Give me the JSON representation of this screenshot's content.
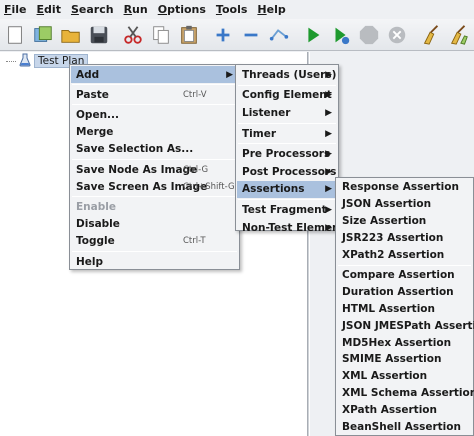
{
  "menubar": [
    {
      "label": "File",
      "mnemonic": "F",
      "rest": "ile"
    },
    {
      "label": "Edit",
      "mnemonic": "E",
      "rest": "dit"
    },
    {
      "label": "Search",
      "mnemonic": "S",
      "rest": "earch"
    },
    {
      "label": "Run",
      "mnemonic": "R",
      "rest": "un"
    },
    {
      "label": "Options",
      "mnemonic": "O",
      "rest": "ptions"
    },
    {
      "label": "Tools",
      "mnemonic": "T",
      "rest": "ools"
    },
    {
      "label": "Help",
      "mnemonic": "H",
      "rest": "elp"
    }
  ],
  "toolbar": [
    {
      "icon": "new-file-icon"
    },
    {
      "icon": "templates-icon"
    },
    {
      "icon": "open-folder-icon"
    },
    {
      "icon": "save-icon"
    },
    {
      "sep": true
    },
    {
      "icon": "cut-icon"
    },
    {
      "icon": "copy-icon"
    },
    {
      "icon": "paste-icon"
    },
    {
      "sep": true
    },
    {
      "icon": "expand-plus-icon"
    },
    {
      "icon": "collapse-minus-icon"
    },
    {
      "icon": "toggle-icon"
    },
    {
      "sep": true
    },
    {
      "icon": "start-icon"
    },
    {
      "icon": "start-no-pauses-icon"
    },
    {
      "icon": "stop-icon"
    },
    {
      "icon": "shutdown-icon"
    },
    {
      "sep": true
    },
    {
      "icon": "clear-icon"
    },
    {
      "icon": "clear-all-icon"
    }
  ],
  "tree": {
    "root_label": "Test Plan"
  },
  "context_menu": [
    {
      "label": "Add",
      "submenu": true,
      "highlight": true
    },
    {
      "sep": true
    },
    {
      "label": "Paste",
      "accel": "Ctrl-V"
    },
    {
      "sep": true
    },
    {
      "label": "Open..."
    },
    {
      "label": "Merge"
    },
    {
      "label": "Save Selection As..."
    },
    {
      "sep": true
    },
    {
      "label": "Save Node As Image",
      "accel": "Ctrl-G"
    },
    {
      "label": "Save Screen As Image",
      "accel": "Ctrl+Shift-G"
    },
    {
      "sep": true
    },
    {
      "label": "Enable",
      "disabled": true
    },
    {
      "label": "Disable"
    },
    {
      "label": "Toggle",
      "accel": "Ctrl-T"
    },
    {
      "sep": true
    },
    {
      "label": "Help"
    }
  ],
  "add_menu": [
    {
      "label": "Threads (Users)",
      "submenu": true
    },
    {
      "sep": true
    },
    {
      "label": "Config Element",
      "submenu": true
    },
    {
      "label": "Listener",
      "submenu": true
    },
    {
      "sep": true
    },
    {
      "label": "Timer",
      "submenu": true
    },
    {
      "sep": true
    },
    {
      "label": "Pre Processors",
      "submenu": true
    },
    {
      "label": "Post Processors",
      "submenu": true
    },
    {
      "label": "Assertions",
      "submenu": true,
      "highlight": true
    },
    {
      "sep": true
    },
    {
      "label": "Test Fragment",
      "submenu": true
    },
    {
      "label": "Non-Test Elements",
      "submenu": true
    }
  ],
  "assertions_menu": [
    {
      "label": "Response Assertion"
    },
    {
      "label": "JSON Assertion"
    },
    {
      "label": "Size Assertion"
    },
    {
      "label": "JSR223 Assertion"
    },
    {
      "label": "XPath2 Assertion"
    },
    {
      "sep": true
    },
    {
      "label": "Compare Assertion"
    },
    {
      "label": "Duration Assertion"
    },
    {
      "label": "HTML Assertion"
    },
    {
      "label": "JSON JMESPath Assertion"
    },
    {
      "label": "MD5Hex Assertion"
    },
    {
      "label": "SMIME Assertion"
    },
    {
      "label": "XML Assertion"
    },
    {
      "label": "XML Schema Assertion"
    },
    {
      "label": "XPath Assertion"
    },
    {
      "label": "BeanShell Assertion"
    }
  ],
  "colors": {
    "highlight": "#aac1de",
    "run_green": "#1e9a2e",
    "stop_gray": "#b9bcc0"
  }
}
